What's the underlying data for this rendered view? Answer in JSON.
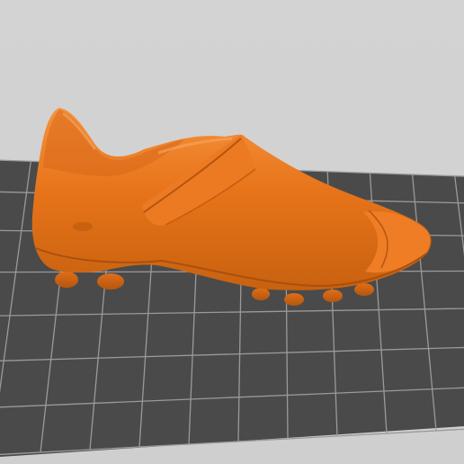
{
  "viewport": {
    "background_top": "#d3d3d3",
    "background_bottom": "#cfcfcf",
    "bed_color": "#4a4a4a",
    "grid_line_color": "#9a9a9a"
  },
  "model": {
    "object": "football-boot",
    "color": "#e8741a",
    "shadow_color": "#b4560f",
    "highlight_color": "#f4933d"
  }
}
